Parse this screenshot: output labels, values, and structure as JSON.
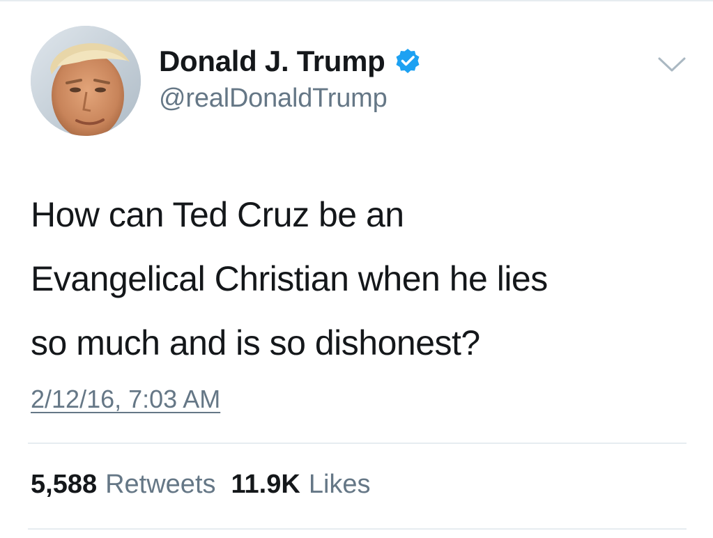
{
  "tweet": {
    "author": {
      "display_name": "Donald J. Trump",
      "handle": "@realDonaldTrump",
      "verified": true,
      "verified_color": "#1da1f2"
    },
    "text_lines": [
      "How can Ted Cruz be an",
      "Evangelical Christian when he lies",
      "so much and is so dishonest?"
    ],
    "timestamp": "2/12/16, 7:03 AM",
    "stats": {
      "retweets_count": "5,588",
      "retweets_label": "Retweets",
      "likes_count": "11.9K",
      "likes_label": "Likes"
    }
  },
  "icons": {
    "avatar": "profile-photo",
    "verified": "verified-badge-icon",
    "menu": "chevron-down-icon"
  },
  "colors": {
    "text_primary": "#14171a",
    "text_secondary": "#657786",
    "divider": "#e6ecf0",
    "brand_blue": "#1da1f2"
  }
}
